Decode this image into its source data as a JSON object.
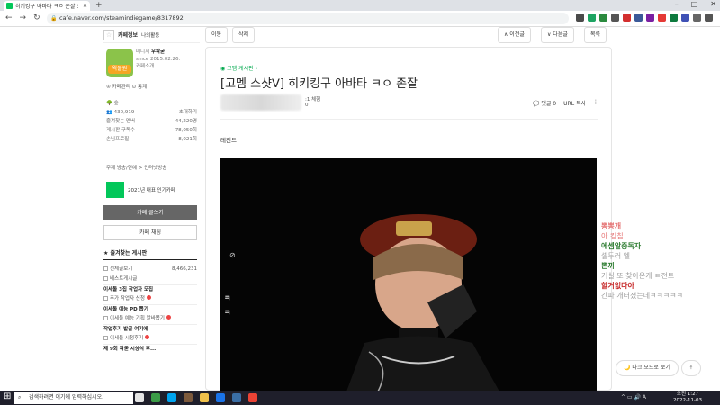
{
  "browser": {
    "tab_title": "히키킹구 아바타 ㅋㅇ 존잘 : 네이버",
    "new_tab": "+",
    "url": "cafe.naver.com/steamindiegame/8317892",
    "lock": "🔒",
    "window_controls": [
      "–",
      "□",
      "✕"
    ],
    "nav": [
      "←",
      "→",
      "↻"
    ],
    "extensions_colors": [
      "#4a4a4a",
      "#1da462",
      "#2b8a3e",
      "#555555",
      "#d32f2f",
      "#3b5998",
      "#7b1fa2",
      "#e53935",
      "#0e7a3e",
      "#3f51b5",
      "#666666",
      "#555555"
    ],
    "ext_labels": [
      "V",
      "O"
    ]
  },
  "sidebar": {
    "star": "☆",
    "tab_cafe_info": "카페정보",
    "tab_my_activity": "나의활동",
    "manager_label": "매니저",
    "manager_name": "우왁굳",
    "since": "since 2015.02.26.",
    "cafe_intro": "카페소개",
    "avatar_text": "왁물원",
    "links": "♔ 카페관리  ⊙ 통계",
    "level": "숲",
    "members": "430,919",
    "invite": "초대하기",
    "stats": [
      {
        "label": "즐겨찾는 멤버",
        "value": "44,220명"
      },
      {
        "label": "게시판 구독수",
        "value": "78,050회"
      },
      {
        "label": "손님프로필",
        "value": "8,021회"
      }
    ],
    "theme": "주제  방송/연예 > 인터넷방송",
    "naver_badge": "NAVER 대표카페",
    "badge_text": "2021년 대표 인기카페",
    "write_button": "카페 글쓰기",
    "chat_button": "카페 채팅",
    "fav_header": "★ 즐겨찾는 게시판",
    "boards": [
      {
        "label": "전체글보기",
        "count": "8,466,231",
        "head": false,
        "dot": false
      },
      {
        "label": "베스트게시글",
        "count": "",
        "head": false,
        "dot": false
      },
      {
        "label": "이세돌 3집 작업자 모집",
        "count": "",
        "head": true,
        "dot": false
      },
      {
        "label": "추가 작업자 신청",
        "count": "",
        "head": false,
        "dot": true
      },
      {
        "label": "이세돌 예능 PD 뽑기",
        "count": "",
        "head": true,
        "dot": false
      },
      {
        "label": "이세돌 예능 기획 알바뽑기",
        "count": "",
        "head": false,
        "dot": true
      },
      {
        "label": "작업후기 발굴 여기에",
        "count": "",
        "head": true,
        "dot": false
      },
      {
        "label": "이세돌 시청후기",
        "count": "",
        "head": false,
        "dot": true
      },
      {
        "label": "제 9회 왁굳 시상식 후...",
        "count": "",
        "head": true,
        "dot": false
      }
    ]
  },
  "article": {
    "btn_move": "이동",
    "btn_delete": "삭제",
    "btn_prev": "∧ 이전글",
    "btn_next": "∨ 다음글",
    "btn_list": "목록",
    "board_link": "고멤 게시판 ›",
    "title": "[고멤 스샷ᐯ] 히키킹구 아바타 ㅋㅇ 존잘",
    "level": ":1 체험",
    "views": "0",
    "comments": "💬 댓글 0",
    "url_copy": "URL 복사",
    "more": "⋮",
    "body": "레전드",
    "kk1": "ㅋ",
    "kk2": "ㅋ"
  },
  "chat": [
    {
      "text": "뽕뽕개",
      "color": "#e57373"
    },
    {
      "text": "아 킹칩",
      "color": "#e57373"
    },
    {
      "text": "에셈알중독자",
      "color": "#2e7d32"
    },
    {
      "text": "셀두러 엘",
      "color": "#9e9e9e"
    },
    {
      "text": "뽄끼",
      "color": "#2e7d32"
    },
    {
      "text": "거실 또 찾아온게 ㅌ전트",
      "color": "#9e9e9e"
    },
    {
      "text": "할거없다아",
      "color": "#c62828"
    },
    {
      "text": "간파 개터졌는데ㅋㅋㅋㅋㅋ",
      "color": "#9e9e9e"
    }
  ],
  "float": {
    "dark_mode": "🌙 다크 모드로 보기",
    "top": "⤒"
  },
  "taskbar": {
    "start": "⊞",
    "search_placeholder": "검색하려면 여기에 입력하십시오.",
    "icons_colors": [
      "#e5e5e5",
      "#3c9c48",
      "#00a4ef",
      "#7d5a3c",
      "#f0c14b",
      "#1a73e8",
      "#3a6ea5",
      "#ea4335"
    ],
    "time": "오전 1:27",
    "date": "2022-11-03",
    "tray": "^ ▭ 🔊 A"
  }
}
